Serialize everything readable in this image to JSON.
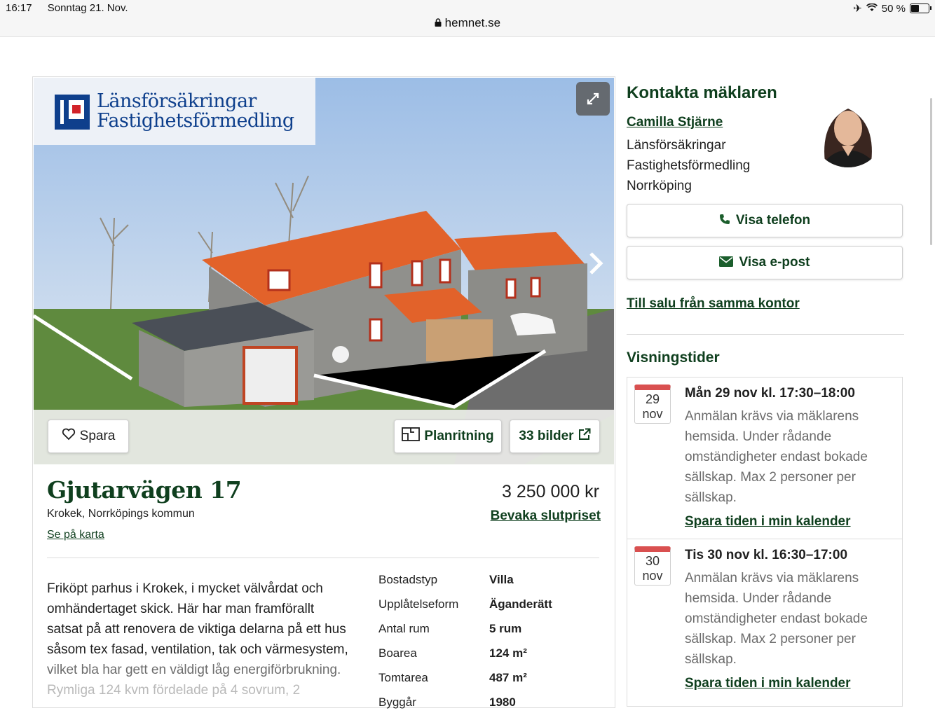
{
  "status_bar": {
    "time": "16:17",
    "date": "Sonntag 21. Nov.",
    "battery": "50 %",
    "url": "hemnet.se"
  },
  "listing": {
    "agency_logo": {
      "line1": "Länsförsäkringar",
      "line2": "Fastighetsförmedling"
    },
    "buttons": {
      "save": "Spara",
      "floorplan": "Planritning",
      "images": "33 bilder"
    },
    "address": "Gjutarvägen 17",
    "area": "Krokek, Norrköpings kommun",
    "map_link": "Se på karta",
    "price": "3 250 000 kr",
    "watch_link": "Bevaka slutpriset",
    "description": {
      "line1": "Friköpt parhus i Krokek, i mycket välvårdat och",
      "line2": "omhändertaget skick. Här har man framförallt",
      "line3": "satsat på att renovera de viktiga delarna på ett hus",
      "line4": "såsom tex fasad, ventilation, tak och värmesystem,",
      "line5": "vilket bla har gett en väldigt låg energiförbrukning.",
      "line6": "Rymliga 124 kvm fördelade på 4 sovrum, 2"
    },
    "facts": [
      {
        "label": "Bostadstyp",
        "value": "Villa"
      },
      {
        "label": "Upplåtelseform",
        "value": "Äganderätt"
      },
      {
        "label": "Antal rum",
        "value": "5 rum"
      },
      {
        "label": "Boarea",
        "value": "124 m²"
      },
      {
        "label": "Tomtarea",
        "value": "487 m²"
      },
      {
        "label": "Byggår",
        "value": "1980"
      }
    ]
  },
  "contact": {
    "heading": "Kontakta mäklaren",
    "agent_name": "Camilla Stjärne",
    "office_line1": "Länsförsäkringar",
    "office_line2": "Fastighetsförmedling",
    "office_line3": "Norrköping",
    "show_phone": "Visa telefon",
    "show_email": "Visa e-post",
    "office_listings_link": "Till salu från samma kontor"
  },
  "viewings": {
    "heading": "Visningstider",
    "items": [
      {
        "day": "29",
        "month": "nov",
        "title": "Mån 29 nov kl. 17:30–18:00",
        "desc1": "Anmälan krävs via mäklarens",
        "desc2": "hemsida. Under rådande",
        "desc3": "omständigheter endast bokade",
        "desc4": "sällskap. Max 2 personer per",
        "desc5": "sällskap.",
        "link": "Spara tiden i min kalender"
      },
      {
        "day": "30",
        "month": "nov",
        "title": "Tis 30 nov kl. 16:30–17:00",
        "desc1": "Anmälan krävs via mäklarens",
        "desc2": "hemsida. Under rådande",
        "desc3": "omständigheter endast bokade",
        "desc4": "sällskap. Max 2 personer per",
        "desc5": "sällskap.",
        "link": "Spara tiden i min kalender"
      }
    ]
  }
}
